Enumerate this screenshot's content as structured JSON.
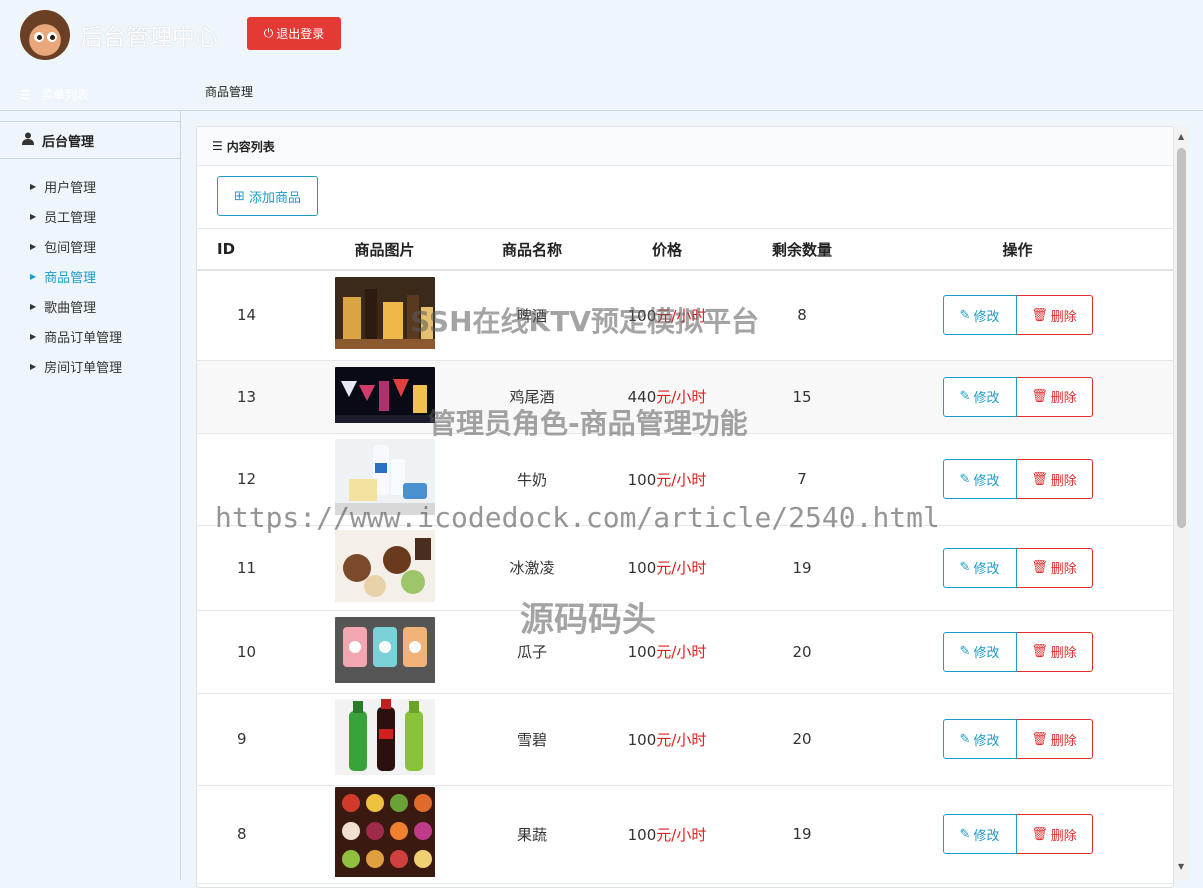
{
  "header": {
    "title": "后台管理中心",
    "logout_label": "退出登录",
    "menu_list_label": "菜单列表",
    "breadcrumb": "商品管理"
  },
  "sidebar": {
    "group_title": "后台管理",
    "items": [
      {
        "label": "用户管理",
        "active": false
      },
      {
        "label": "员工管理",
        "active": false
      },
      {
        "label": "包间管理",
        "active": false
      },
      {
        "label": "商品管理",
        "active": true
      },
      {
        "label": "歌曲管理",
        "active": false
      },
      {
        "label": "商品订单管理",
        "active": false
      },
      {
        "label": "房间订单管理",
        "active": false
      }
    ]
  },
  "panel": {
    "title": "内容列表",
    "add_label": "添加商品"
  },
  "table": {
    "columns": [
      "ID",
      "商品图片",
      "商品名称",
      "价格",
      "剩余数量",
      "操作"
    ],
    "edit_label": "修改",
    "delete_label": "删除",
    "rows": [
      {
        "id": "14",
        "name": "啤酒",
        "price": "100",
        "unit": "元/小时",
        "stock": "8"
      },
      {
        "id": "13",
        "name": "鸡尾酒",
        "price": "440",
        "unit": "元/小时",
        "stock": "15"
      },
      {
        "id": "12",
        "name": "牛奶",
        "price": "100",
        "unit": "元/小时",
        "stock": "7"
      },
      {
        "id": "11",
        "name": "冰激凌",
        "price": "100",
        "unit": "元/小时",
        "stock": "19"
      },
      {
        "id": "10",
        "name": "瓜子",
        "price": "100",
        "unit": "元/小时",
        "stock": "20"
      },
      {
        "id": "9",
        "name": "雪碧",
        "price": "100",
        "unit": "元/小时",
        "stock": "20"
      },
      {
        "id": "8",
        "name": "果蔬",
        "price": "100",
        "unit": "元/小时",
        "stock": "19"
      }
    ]
  },
  "watermark": {
    "line1": "SSH在线KTV预定模拟平台",
    "line2": "管理员角色-商品管理功能",
    "line3": "https://www.icodedock.com/article/2540.html",
    "line4": "源码码头"
  },
  "colors": {
    "accent": "#1b9cc9",
    "danger": "#e53935",
    "price_unit": "#e02020",
    "background": "#eef6fb"
  }
}
